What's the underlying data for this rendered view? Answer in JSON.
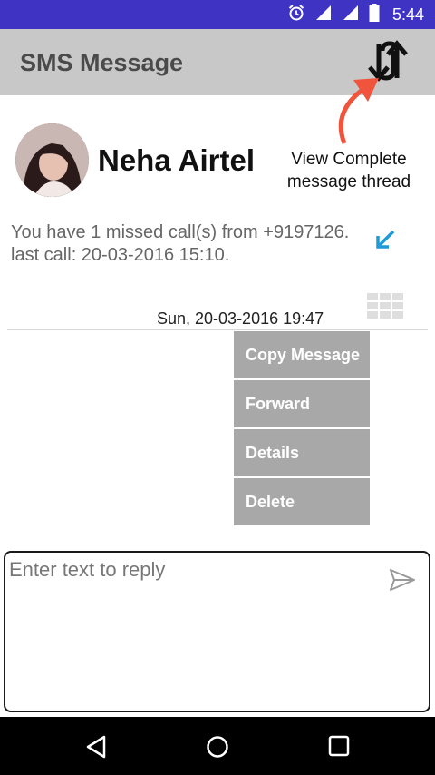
{
  "status_bar": {
    "time": "5:44",
    "icons": [
      "alarm-icon",
      "wifi-icon",
      "signal-icon",
      "battery-icon"
    ]
  },
  "app_bar": {
    "title": "SMS Message",
    "thread_icon": "swap-arrows-icon"
  },
  "contact": {
    "name": "Neha Airtel",
    "avatar": "avatar"
  },
  "callout": {
    "line1": "View Complete",
    "line2": "message thread"
  },
  "message": {
    "body": "You have 1 missed call(s) from +9197126. last call: 20-03-2016 15:10.",
    "timestamp": "Sun, 20-03-2016 19:47",
    "type_icon": "missed-call-icon"
  },
  "context_menu": {
    "items": [
      {
        "label": "Copy Message"
      },
      {
        "label": "Forward"
      },
      {
        "label": "Details"
      },
      {
        "label": "Delete"
      }
    ]
  },
  "reply": {
    "placeholder": "Enter text to reply",
    "value": "",
    "send_icon": "send-icon"
  },
  "nav_bar": {
    "icons": [
      "back-icon",
      "home-icon",
      "recents-icon"
    ]
  },
  "colors": {
    "status_bar": "#3f33c4",
    "app_bar": "#c8c8c8",
    "menu_item": "#a8a8a8",
    "accent_arrow": "#f0543c",
    "missed_icon": "#1e9ad6"
  }
}
